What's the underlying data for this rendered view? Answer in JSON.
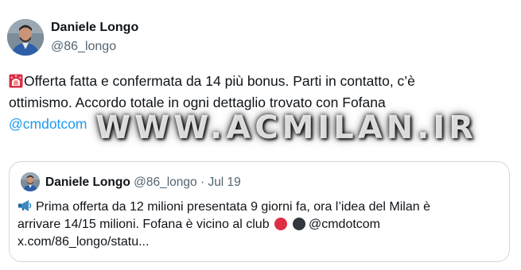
{
  "tweet": {
    "author_name": "Daniele Longo",
    "author_handle": "@86_longo",
    "avatar_icon": "profile-photo",
    "siren_icon": "police-car-light-emoji",
    "text_line1": "Offerta fatta e confermata da 14 più bonus. Parti in contatto, c’è",
    "text_line2": "ottimismo. Accordo totale in ogni dettaglio trovato con Fofana",
    "mention": "@cmdotcom"
  },
  "watermark": {
    "text": "WWW.ACMILAN.IR"
  },
  "quoted_tweet": {
    "author_name": "Daniele Longo",
    "author_handle": "@86_longo",
    "separator": "·",
    "date": "Jul 19",
    "megaphone_icon": "megaphone-emoji",
    "text_line1": "Prima offerta da 12 milioni presentata 9 giorni fa, ora l’idea del Milan è",
    "text_line2_a": "arrivare 14/15 milioni. Fofana è vicino al club",
    "red_dot_color": "#dd2e44",
    "black_dot_color": "#31373d",
    "text_line2_mention": "@cmdotcom",
    "text_line3": "x.com/86_longo/statu..."
  },
  "colors": {
    "text": "#0f1419",
    "secondary": "#536471",
    "link": "#1d9bf0",
    "border": "#cfd9de"
  }
}
